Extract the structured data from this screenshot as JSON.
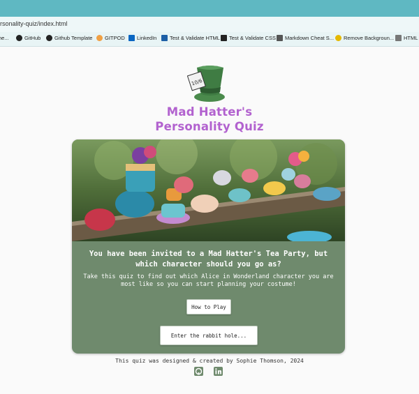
{
  "browser": {
    "url": "rsonality-quiz/index.html",
    "bookmarks": [
      {
        "label": "he...",
        "icon": "bookmark-icon"
      },
      {
        "label": "GitHub",
        "icon": "github-icon"
      },
      {
        "label": "Github Template",
        "icon": "github-icon"
      },
      {
        "label": "GITPOD",
        "icon": "gitpod-icon"
      },
      {
        "label": "LinkedIn",
        "icon": "linkedin-icon"
      },
      {
        "label": "Test & Validate HTML",
        "icon": "w3c-icon"
      },
      {
        "label": "Test & Validate CSS",
        "icon": "css-validator-icon"
      },
      {
        "label": "Markdown Cheat S...",
        "icon": "markdown-icon"
      },
      {
        "label": "Remove Backgroun...",
        "icon": "remove-bg-icon"
      },
      {
        "label": "HTML C",
        "icon": "document-icon"
      }
    ]
  },
  "header": {
    "title_line1": "Mad Hatter's",
    "title_line2": "Personality Quiz",
    "logo_text": "10/6"
  },
  "card": {
    "headline": "You have been invited to a Mad Hatter's Tea Party, but which character should you go as?",
    "subtext": "Take this quiz to find out which Alice in Wonderland character you are most like so you can start planning your costume!",
    "how_to_label": "How to Play",
    "enter_label": "Enter the rabbit hole..."
  },
  "footer": {
    "credit": "This quiz was designed & created by Sophie Thomson, 2024",
    "social": [
      "github-icon",
      "linkedin-icon"
    ]
  },
  "colors": {
    "accent": "#b262cf",
    "card_bg": "#6f8a6d",
    "browser_teal": "#5fb8c2"
  }
}
